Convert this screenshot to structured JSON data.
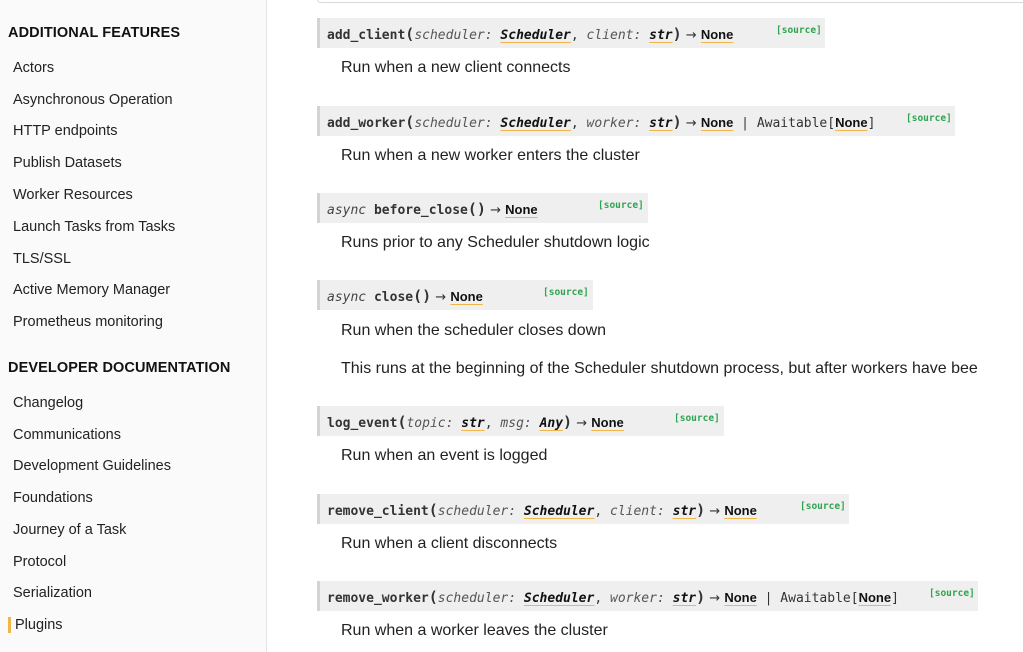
{
  "sidebar": {
    "sections": [
      {
        "title": "ADDITIONAL FEATURES",
        "items": [
          "Actors",
          "Asynchronous Operation",
          "HTTP endpoints",
          "Publish Datasets",
          "Worker Resources",
          "Launch Tasks from Tasks",
          "TLS/SSL",
          "Active Memory Manager",
          "Prometheus monitoring"
        ]
      },
      {
        "title": "DEVELOPER DOCUMENTATION",
        "items": [
          "Changelog",
          "Communications",
          "Development Guidelines",
          "Foundations",
          "Journey of a Task",
          "Protocol",
          "Serialization",
          "Plugins"
        ]
      }
    ],
    "active_item": "Plugins"
  },
  "methods": [
    {
      "prefix": "",
      "name": "add_client",
      "params": [
        {
          "name": "scheduler",
          "type": "Scheduler"
        },
        {
          "name": "client",
          "type": "str"
        }
      ],
      "returns": [
        "None"
      ],
      "source": "[source]",
      "descriptions": [
        "Run when a new client connects"
      ]
    },
    {
      "prefix": "",
      "name": "add_worker",
      "params": [
        {
          "name": "scheduler",
          "type": "Scheduler"
        },
        {
          "name": "worker",
          "type": "str"
        }
      ],
      "returns": [
        "None",
        " | Awaitable[",
        "None",
        "]"
      ],
      "source": "[source]",
      "descriptions": [
        "Run when a new worker enters the cluster"
      ]
    },
    {
      "prefix": "async",
      "name": "before_close",
      "params": [],
      "returns": [
        "None"
      ],
      "source": "[source]",
      "descriptions": [
        "Runs prior to any Scheduler shutdown logic"
      ]
    },
    {
      "prefix": "async",
      "name": "close",
      "params": [],
      "returns": [
        "None"
      ],
      "source": "[source]",
      "descriptions": [
        "Run when the scheduler closes down",
        "This runs at the beginning of the Scheduler shutdown process, but after workers have bee"
      ]
    },
    {
      "prefix": "",
      "name": "log_event",
      "params": [
        {
          "name": "topic",
          "type": "str"
        },
        {
          "name": "msg",
          "type": "Any"
        }
      ],
      "returns": [
        "None"
      ],
      "source": "[source]",
      "descriptions": [
        "Run when an event is logged"
      ]
    },
    {
      "prefix": "",
      "name": "remove_client",
      "params": [
        {
          "name": "scheduler",
          "type": "Scheduler"
        },
        {
          "name": "client",
          "type": "str"
        }
      ],
      "returns": [
        "None"
      ],
      "source": "[source]",
      "descriptions": [
        "Run when a client disconnects"
      ]
    },
    {
      "prefix": "",
      "name": "remove_worker",
      "params": [
        {
          "name": "scheduler",
          "type": "Scheduler"
        },
        {
          "name": "worker",
          "type": "str"
        }
      ],
      "returns": [
        "None",
        " | Awaitable[",
        "None",
        "]"
      ],
      "source": "[source]",
      "descriptions": [
        "Run when a worker leaves the cluster"
      ]
    }
  ]
}
